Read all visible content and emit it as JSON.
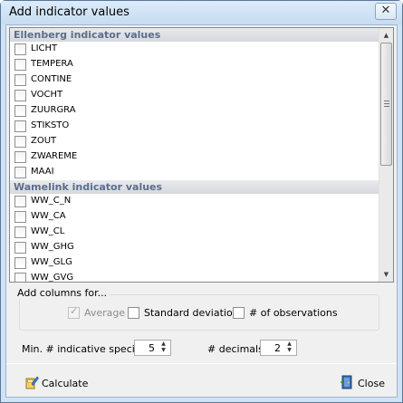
{
  "window": {
    "title": "Add indicator values",
    "close_glyph": "✕"
  },
  "list": {
    "groups": [
      {
        "header": "Ellenberg indicator values",
        "items": [
          "LICHT",
          "TEMPERA",
          "CONTINE",
          "VOCHT",
          "ZUURGRA",
          "STIKSTO",
          "ZOUT",
          "ZWAREME",
          "MAAI"
        ]
      },
      {
        "header": "Wamelink indicator values",
        "items": [
          "WW_C_N",
          "WW_CA",
          "WW_CL",
          "WW_GHG",
          "WW_GLG",
          "WW_GVG"
        ]
      }
    ],
    "scroll_up_glyph": "▲",
    "scroll_down_glyph": "▼",
    "scroll_position": 0.0
  },
  "columns_group": {
    "label": "Add columns for...",
    "options": [
      {
        "label": "Average",
        "checked": true,
        "enabled": false
      },
      {
        "label": "Standard deviation",
        "checked": false,
        "enabled": true
      },
      {
        "label": "# of observations",
        "checked": false,
        "enabled": true
      }
    ]
  },
  "settings": {
    "min_species_label": "Min. # indicative species",
    "min_species_value": "5",
    "decimals_label": "# decimals",
    "decimals_value": "2",
    "spin_up_glyph": "▲",
    "spin_down_glyph": "▼"
  },
  "buttons": {
    "calculate_label": "Calculate",
    "close_label": "Close"
  },
  "icons": {
    "calculate": "calculator-pen-icon",
    "close": "door-exit-icon"
  }
}
